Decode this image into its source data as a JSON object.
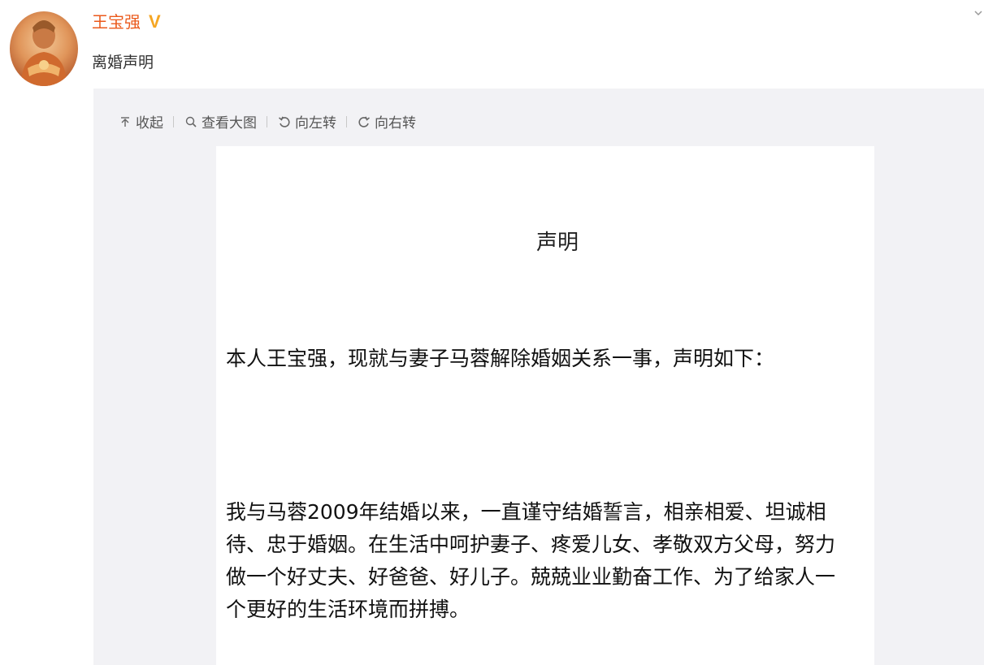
{
  "post": {
    "username": "王宝强",
    "verified_badge": "V",
    "text": "离婚声明"
  },
  "toolbar": {
    "collapse_label": "收起",
    "view_large_label": "查看大图",
    "rotate_left_label": "向左转",
    "rotate_right_label": "向右转"
  },
  "document": {
    "title": "声明",
    "paragraph_1": "本人王宝强，现就与妻子马蓉解除婚姻关系一事，声明如下：",
    "paragraph_2": "我与马蓉2009年结婚以来，一直谨守结婚誓言，相亲相爱、坦诚相待、忠于婚姻。在生活中呵护妻子、疼爱儿女、孝敬双方父母，努力做一个好丈夫、好爸爸、好儿子。兢兢业业勤奋工作、为了给家人一个更好的生活环境而拼搏。"
  },
  "colors": {
    "username": "#eb5a1c",
    "verified": "#f5a623",
    "media_background": "#f2f2f5"
  },
  "icons": [
    "avatar",
    "verified-icon",
    "more-chevron-icon",
    "collapse-up-arrow-icon",
    "search-icon",
    "rotate-left-icon",
    "rotate-right-icon"
  ]
}
